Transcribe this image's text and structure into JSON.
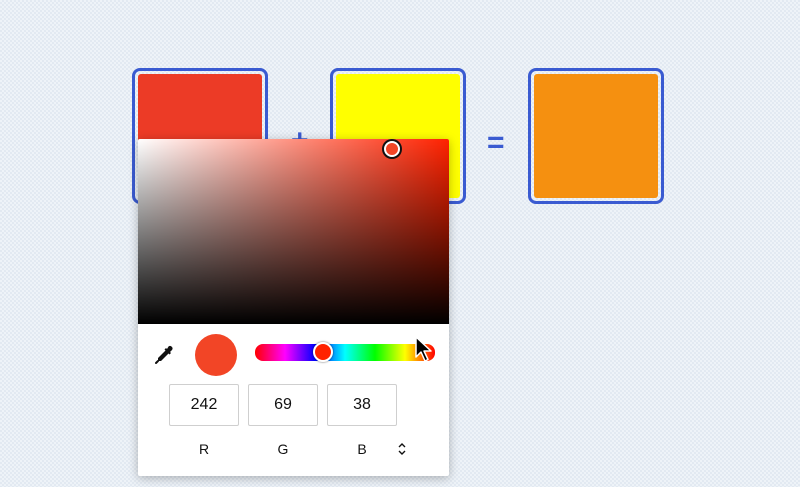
{
  "colors": {
    "swatch1": "#ec3b26",
    "swatch2": "#ffff00",
    "swatch3": "#f59010",
    "accent": "#3a5bd1",
    "current_hue": "#ff2200"
  },
  "operators": {
    "plus": "+",
    "equals": "="
  },
  "picker": {
    "values": {
      "r": "242",
      "g": "69",
      "b": "38"
    },
    "labels": {
      "r": "R",
      "g": "G",
      "b": "B"
    },
    "mode": "RGB",
    "hue_position": 0.98,
    "saturation": 0.82,
    "brightness": 0.95
  },
  "icons": {
    "eyedropper": "eyedropper-icon",
    "mode_toggle": "chevron-updown-icon",
    "cursor": "mouse-pointer-icon"
  }
}
